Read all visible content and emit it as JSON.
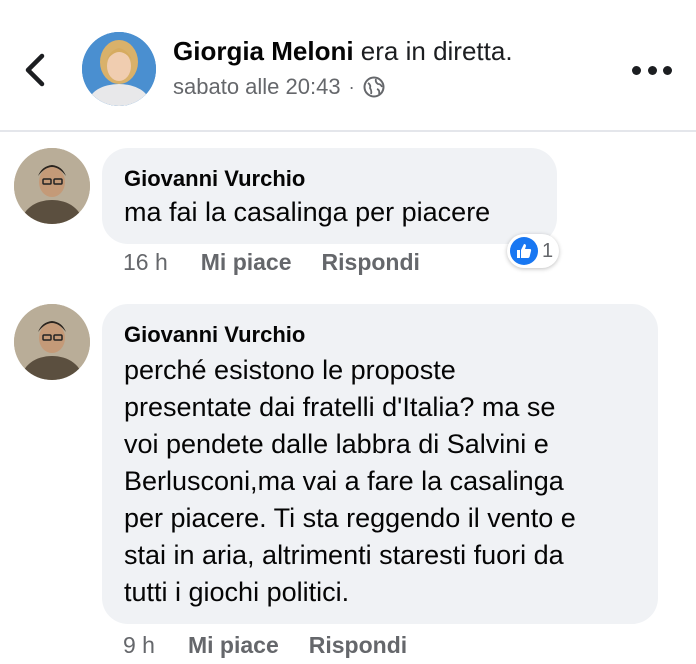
{
  "header": {
    "page_name": "Giorgia Meloni",
    "action_text": " era in diretta.",
    "timestamp": "sabato alle 20:43",
    "separator": "·",
    "privacy_icon": "globe-icon",
    "back_icon": "chevron-left-icon",
    "more_icon": "more-dots-icon"
  },
  "comments": [
    {
      "author": "Giovanni Vurchio",
      "text": "ma fai la casalinga per piacere",
      "time": "16 h",
      "like_label": "Mi piace",
      "reply_label": "Rispondi",
      "reaction_count": "1",
      "reaction_icon": "like-icon"
    },
    {
      "author": "Giovanni Vurchio",
      "text_lines": [
        "perché esistono le proposte",
        "presentate dai fratelli d'Italia? ma se",
        "voi pendete dalle labbra di Salvini e",
        "Berlusconi,ma vai a fare la casalinga",
        "per piacere. Ti sta reggendo il vento e",
        "stai in aria, altrimenti staresti fuori da",
        "tutti i giochi politici."
      ],
      "time": "9 h",
      "like_label": "Mi piace",
      "reply_label": "Rispondi"
    }
  ],
  "colors": {
    "bubble": "#f0f2f5",
    "secondary_text": "#65676b",
    "like_blue": "#1877f2"
  }
}
